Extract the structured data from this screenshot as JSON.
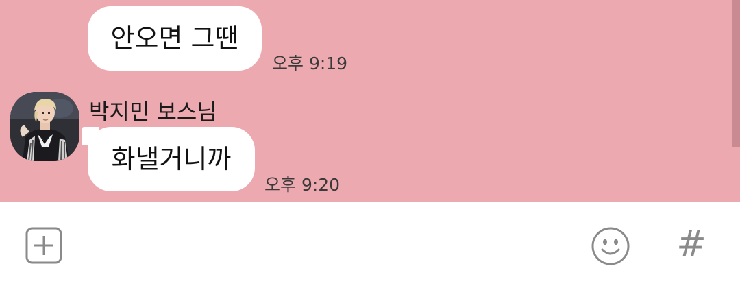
{
  "messages": [
    {
      "text": "안오면 그땐",
      "time": "오후 9:19"
    },
    {
      "sender": "박지민 보스님",
      "text": "화낼거니까",
      "time": "오후 9:20"
    }
  ],
  "input_bar": {
    "plus_icon": "plus-square-icon",
    "emoji_icon": "emoji-icon",
    "hash_label": "#"
  },
  "colors": {
    "chat_background": "#eca9b0",
    "bubble": "#ffffff",
    "icon_gray": "#8a8a8a"
  }
}
